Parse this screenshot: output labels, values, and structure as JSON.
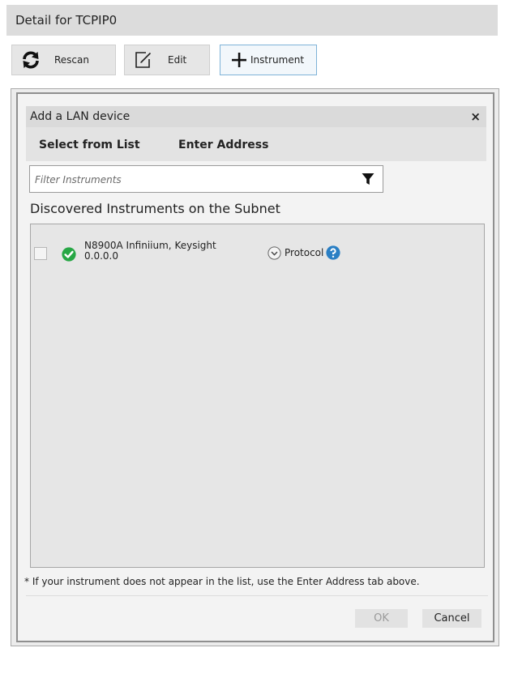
{
  "header": {
    "title": "Detail for TCPIP0"
  },
  "toolbar": {
    "rescan_label": "Rescan",
    "edit_label": "Edit",
    "instrument_label": "Instrument"
  },
  "dialog": {
    "title": "Add a LAN device",
    "close_label": "×",
    "tabs": [
      {
        "label": "Select from List"
      },
      {
        "label": "Enter Address"
      }
    ],
    "filter_placeholder": "Filter Instruments",
    "list_heading": "Discovered Instruments on the Subnet",
    "instruments": [
      {
        "name": "N8900A Infiniium, Keysight",
        "address": "0.0.0.0",
        "protocol_label": "Protocol",
        "checked": false,
        "status": "ok"
      }
    ],
    "footnote": "* If your instrument does not appear in the list, use the Enter Address tab above.",
    "ok_label": "OK",
    "cancel_label": "Cancel"
  },
  "colors": {
    "status_ok": "#27a745",
    "help_blue": "#2a7fc4",
    "primary_border": "#7fb3d8"
  },
  "icons": {
    "rescan": "refresh-icon",
    "edit": "edit-icon",
    "instrument": "plus-icon",
    "filter": "filter-icon",
    "status": "check-circle-icon",
    "protocol": "chevron-down-circle-icon",
    "help": "help-icon"
  }
}
